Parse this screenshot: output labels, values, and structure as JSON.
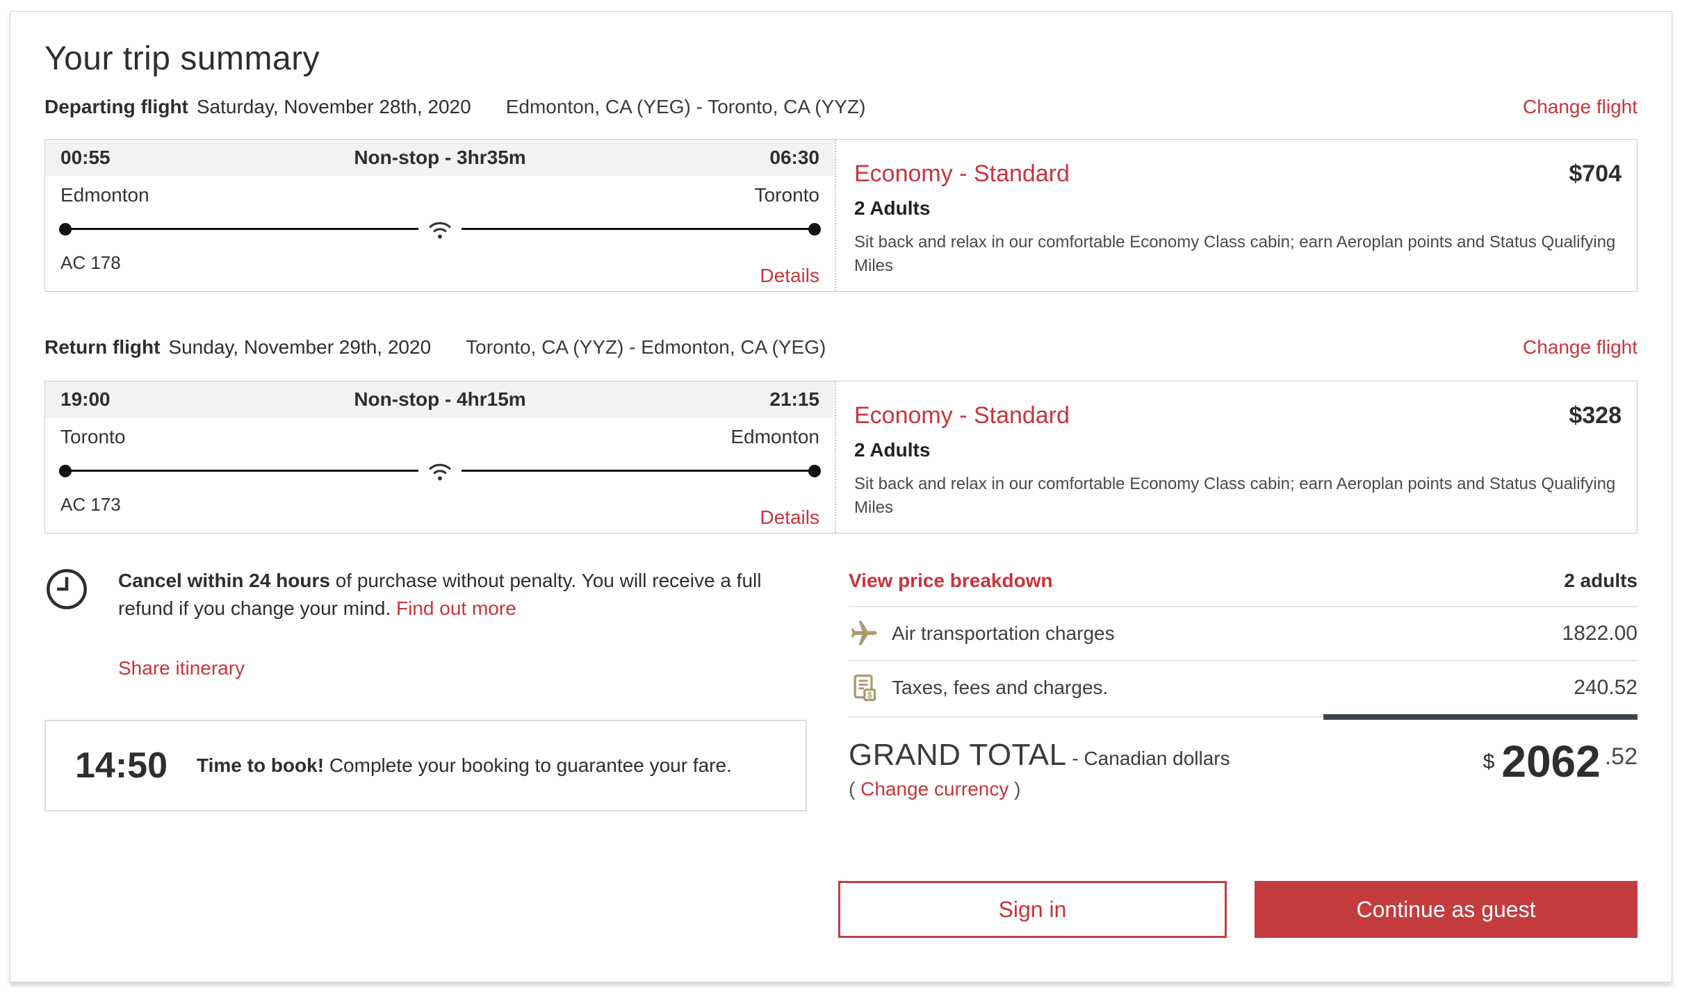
{
  "title": "Your trip summary",
  "flights": [
    {
      "section_label": "Departing flight",
      "date": "Saturday, November 28th, 2020",
      "route": "Edmonton, CA (YEG) - Toronto, CA (YYZ)",
      "change_link": "Change flight",
      "depart_time": "00:55",
      "stops_duration": "Non-stop - 3hr35m",
      "arrive_time": "06:30",
      "origin": "Edmonton",
      "destination": "Toronto",
      "flight_number": "AC 178",
      "details_link": "Details",
      "fare_name": "Economy - Standard",
      "fare_price": "$704",
      "passengers": "2 Adults",
      "fare_description": "Sit back and relax in our comfortable Economy Class cabin; earn Aeroplan points and Status Qualifying Miles"
    },
    {
      "section_label": "Return flight",
      "date": "Sunday, November 29th, 2020",
      "route": "Toronto, CA (YYZ) - Edmonton, CA (YEG)",
      "change_link": "Change flight",
      "depart_time": "19:00",
      "stops_duration": "Non-stop - 4hr15m",
      "arrive_time": "21:15",
      "origin": "Toronto",
      "destination": "Edmonton",
      "flight_number": "AC 173",
      "details_link": "Details",
      "fare_name": "Economy - Standard",
      "fare_price": "$328",
      "passengers": "2 Adults",
      "fare_description": "Sit back and relax in our comfortable Economy Class cabin; earn Aeroplan points and Status Qualifying Miles"
    }
  ],
  "cancel_notice": {
    "bold": "Cancel within 24 hours",
    "text": " of purchase without penalty. You will receive a full refund if you change your mind. ",
    "link": "Find out more"
  },
  "share_link": "Share itinerary",
  "book_timer": {
    "time": "14:50",
    "bold": "Time to book!",
    "text": " Complete your booking to guarantee your fare."
  },
  "price_breakdown": {
    "view_link": "View price breakdown",
    "adults": "2 adults",
    "rows": [
      {
        "icon": "airplane-icon",
        "label": "Air transportation charges",
        "amount": "1822.00"
      },
      {
        "icon": "taxes-icon",
        "label": "Taxes, fees and charges.",
        "amount": "240.52"
      }
    ],
    "grand_total": {
      "label": "GRAND TOTAL",
      "currency_note": "- Canadian dollars",
      "paren_open": "(",
      "change_currency": "Change currency",
      "paren_close": ")",
      "currency_symbol": "$",
      "dollars": "2062",
      "cents": ".52"
    }
  },
  "actions": {
    "sign_in": "Sign in",
    "continue_guest": "Continue as guest"
  },
  "icons": {
    "wifi": "wifi-icon",
    "clock": "clock-icon",
    "airplane": "airplane-icon",
    "taxes": "taxes-icon"
  },
  "colors": {
    "accent_red": "#c8353b",
    "button_red": "#c43c3e",
    "icon_gold": "#ab9a6d",
    "total_bar": "#3f434b"
  }
}
